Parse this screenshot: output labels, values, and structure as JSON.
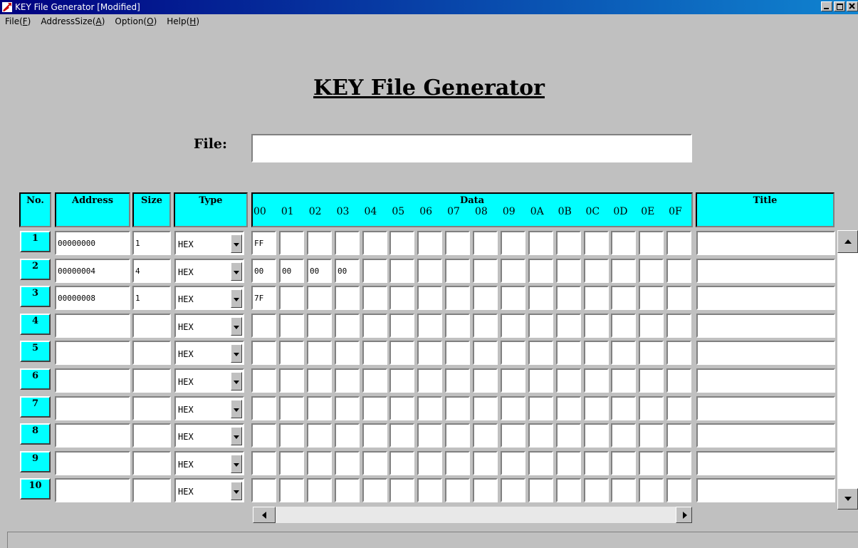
{
  "window": {
    "title": "KEY File Generator [Modified]",
    "accent_color": "#000080",
    "header_color": "#00ffff"
  },
  "menu": [
    {
      "label": "File(",
      "key": "F",
      "end": ")"
    },
    {
      "label": "AddressSize(",
      "key": "A",
      "end": ")"
    },
    {
      "label": "Option(",
      "key": "O",
      "end": ")"
    },
    {
      "label": "Help(",
      "key": "H",
      "end": ")"
    }
  ],
  "heading": "KEY File Generator",
  "file": {
    "label": "File:",
    "value": ""
  },
  "columns": {
    "no": "No.",
    "address": "Address",
    "size": "Size",
    "type": "Type",
    "data": "Data",
    "title": "Title",
    "hex_offsets": [
      "00",
      "01",
      "02",
      "03",
      "04",
      "05",
      "06",
      "07",
      "08",
      "09",
      "0A",
      "0B",
      "0C",
      "0D",
      "0E",
      "0F"
    ]
  },
  "rows": [
    {
      "no": "1",
      "address": "00000000",
      "size": "1",
      "type": "HEX",
      "data": [
        "FF",
        "",
        "",
        "",
        "",
        "",
        "",
        "",
        "",
        "",
        "",
        "",
        "",
        "",
        "",
        ""
      ],
      "title": ""
    },
    {
      "no": "2",
      "address": "00000004",
      "size": "4",
      "type": "HEX",
      "data": [
        "00",
        "00",
        "00",
        "00",
        "",
        "",
        "",
        "",
        "",
        "",
        "",
        "",
        "",
        "",
        "",
        ""
      ],
      "title": ""
    },
    {
      "no": "3",
      "address": "00000008",
      "size": "1",
      "type": "HEX",
      "data": [
        "7F",
        "",
        "",
        "",
        "",
        "",
        "",
        "",
        "",
        "",
        "",
        "",
        "",
        "",
        "",
        ""
      ],
      "title": ""
    },
    {
      "no": "4",
      "address": "",
      "size": "",
      "type": "HEX",
      "data": [
        "",
        "",
        "",
        "",
        "",
        "",
        "",
        "",
        "",
        "",
        "",
        "",
        "",
        "",
        "",
        ""
      ],
      "title": ""
    },
    {
      "no": "5",
      "address": "",
      "size": "",
      "type": "HEX",
      "data": [
        "",
        "",
        "",
        "",
        "",
        "",
        "",
        "",
        "",
        "",
        "",
        "",
        "",
        "",
        "",
        ""
      ],
      "title": ""
    },
    {
      "no": "6",
      "address": "",
      "size": "",
      "type": "HEX",
      "data": [
        "",
        "",
        "",
        "",
        "",
        "",
        "",
        "",
        "",
        "",
        "",
        "",
        "",
        "",
        "",
        ""
      ],
      "title": ""
    },
    {
      "no": "7",
      "address": "",
      "size": "",
      "type": "HEX",
      "data": [
        "",
        "",
        "",
        "",
        "",
        "",
        "",
        "",
        "",
        "",
        "",
        "",
        "",
        "",
        "",
        ""
      ],
      "title": ""
    },
    {
      "no": "8",
      "address": "",
      "size": "",
      "type": "HEX",
      "data": [
        "",
        "",
        "",
        "",
        "",
        "",
        "",
        "",
        "",
        "",
        "",
        "",
        "",
        "",
        "",
        ""
      ],
      "title": ""
    },
    {
      "no": "9",
      "address": "",
      "size": "",
      "type": "HEX",
      "data": [
        "",
        "",
        "",
        "",
        "",
        "",
        "",
        "",
        "",
        "",
        "",
        "",
        "",
        "",
        "",
        ""
      ],
      "title": ""
    },
    {
      "no": "10",
      "address": "",
      "size": "",
      "type": "HEX",
      "data": [
        "",
        "",
        "",
        "",
        "",
        "",
        "",
        "",
        "",
        "",
        "",
        "",
        "",
        "",
        "",
        ""
      ],
      "title": ""
    }
  ],
  "icons": {
    "app": "key-file-generator-app-icon",
    "minimize": "minimize-icon",
    "maximize": "maximize-icon",
    "close": "close-icon",
    "dropdown": "chevron-down-icon",
    "scroll_up": "scroll-up-arrow-icon",
    "scroll_down": "scroll-down-arrow-icon",
    "scroll_left": "scroll-left-arrow-icon",
    "scroll_right": "scroll-right-arrow-icon"
  }
}
